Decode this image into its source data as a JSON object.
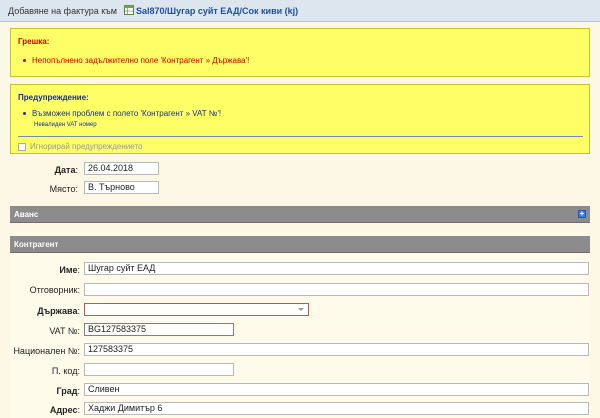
{
  "header": {
    "title_prefix": "Добавяне на фактура към",
    "document_link": "Sal870/Шугар суйт ЕАД/Сок киви (kj)"
  },
  "error_box": {
    "heading": "Грешка:",
    "message": "Непопълнено задължително поле 'Контрагент » Държава'!"
  },
  "warning_box": {
    "heading": "Предупреждение:",
    "message": "Възможен проблем с полето 'Контрагент » VAT №'!",
    "detail": "Невалиден VAT номер",
    "ignore_label": "Игнорирай предупреждението"
  },
  "form": {
    "date": {
      "label": "Дата",
      "value": "26.04.2018"
    },
    "place": {
      "label": "Място:",
      "value": "В. Търново"
    }
  },
  "sections": {
    "advance": "Аванс",
    "counterparty": "Контрагент"
  },
  "counterparty": {
    "name": {
      "label": "Име",
      "value": "Шугар суйт ЕАД"
    },
    "responsible": {
      "label": "Отговорник:",
      "value": ""
    },
    "country": {
      "label": "Държава",
      "value": ""
    },
    "vat": {
      "label": "VAT №:",
      "value": "BG127583375"
    },
    "national_no": {
      "label": "Национален №:",
      "value": "127583375"
    },
    "postal_code": {
      "label": "П. код:",
      "value": ""
    },
    "city": {
      "label": "Град",
      "value": "Сливен"
    },
    "address": {
      "label": "Адрес",
      "value": "Хаджи Димитър 6"
    }
  },
  "colors": {
    "error": "#cc0000",
    "warning_text": "#1a2f8f",
    "box_bg": "#fefe66",
    "section_bar": "#8c8c8c",
    "link": "#1f4f99"
  },
  "icons": [
    "spreadsheet-icon",
    "expand-plus-icon",
    "dropdown-arrow-icon"
  ]
}
